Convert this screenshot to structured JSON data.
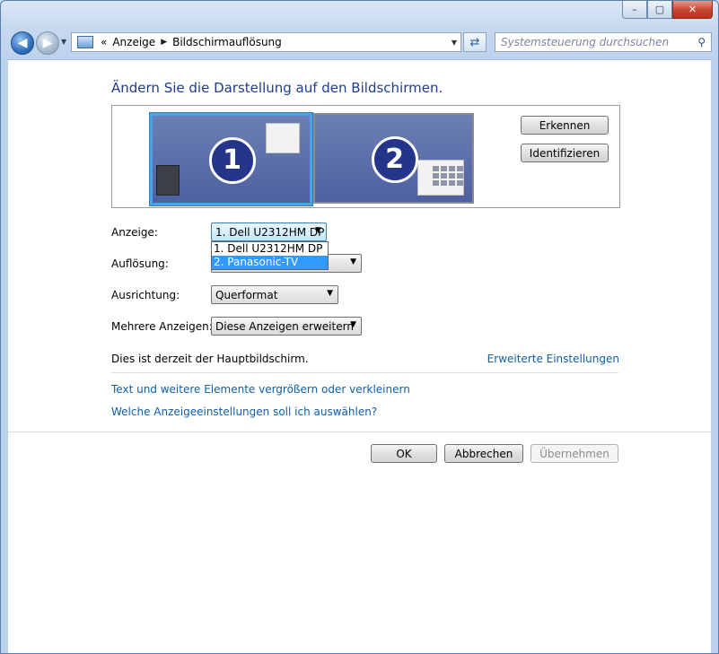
{
  "window": {
    "caption_min": "–",
    "caption_max": "▢",
    "caption_close": "✕"
  },
  "nav": {
    "back_glyph": "◀",
    "forward_glyph": "▶",
    "chevrons": "«",
    "breadcrumb": [
      "Anzeige",
      "Bildschirmauflösung"
    ],
    "search_placeholder": "Systemsteuerung durchsuchen"
  },
  "main": {
    "title": "Ändern Sie die Darstellung auf den Bildschirmen.",
    "monitors": [
      {
        "number": "1",
        "selected": true
      },
      {
        "number": "2",
        "selected": false
      }
    ],
    "detect_button": "Erkennen",
    "identify_button": "Identifizieren",
    "fields": {
      "display_label": "Anzeige:",
      "display_value": "1. Dell U2312HM DP",
      "display_options": [
        "1. Dell U2312HM DP",
        "2. Panasonic-TV"
      ],
      "display_highlighted": "2. Panasonic-TV",
      "resolution_label": "Auflösung:",
      "resolution_value_tail": ")",
      "orientation_label": "Ausrichtung:",
      "orientation_value": "Querformat",
      "multiple_label": "Mehrere Anzeigen:",
      "multiple_value": "Diese Anzeigen erweitern"
    },
    "primary_info": "Dies ist derzeit der Hauptbildschirm.",
    "advanced_link": "Erweiterte Einstellungen",
    "links": [
      "Text und weitere Elemente vergrößern oder verkleinern",
      "Welche Anzeigeeinstellungen soll ich auswählen?"
    ],
    "ok_button": "OK",
    "cancel_button": "Abbrechen",
    "apply_button": "Übernehmen"
  },
  "colors": {
    "title_blue": "#1e3d8f",
    "link_blue": "#0f5ea8",
    "selection_blue": "#3399ff"
  }
}
